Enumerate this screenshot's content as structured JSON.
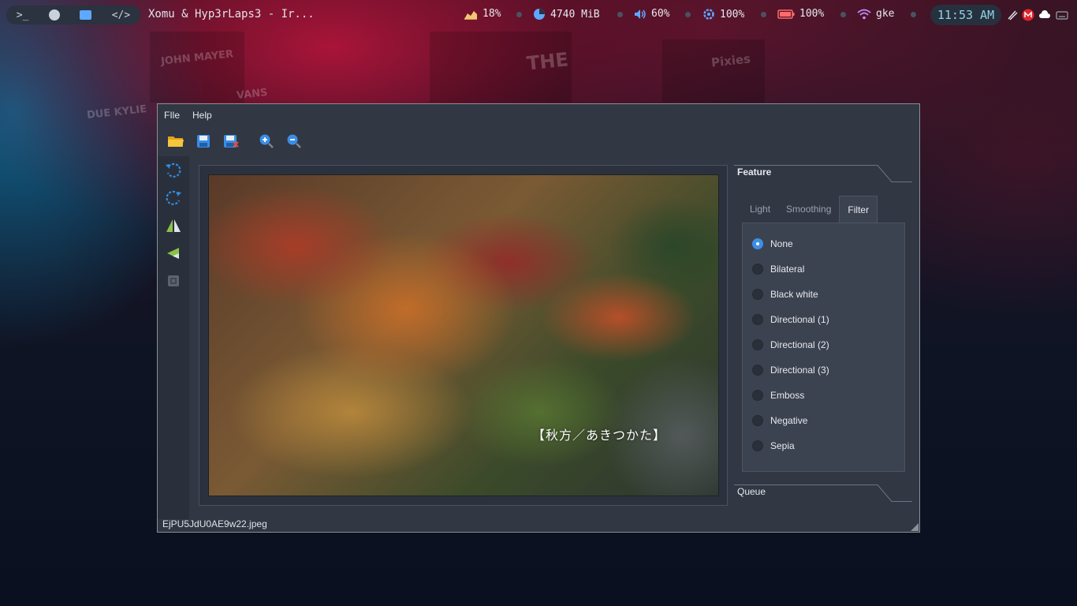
{
  "desktop": {
    "poster_texts": [
      "JOHN MAYER",
      "VANS",
      "Pixies",
      "THE",
      "DUE KYLIE"
    ]
  },
  "topbar": {
    "launcher": [
      {
        "name": "terminal-icon",
        "glyph": ">_"
      },
      {
        "name": "firefox-icon",
        "glyph": ""
      },
      {
        "name": "folder-icon",
        "glyph": ""
      },
      {
        "name": "code-icon",
        "glyph": "</>"
      }
    ],
    "window_title": "Xomu & Hyp3rLaps3 - Ir...",
    "cpu": "18%",
    "memory": "4740 MiB",
    "volume": "60%",
    "brightness": "100%",
    "battery": "100%",
    "wifi": "gke",
    "clock": "11:53 AM",
    "colors": {
      "accent": "#5fa8ff",
      "clock": "#8fd3e8",
      "battery": "#ff6b6b",
      "wifi": "#c58cff",
      "cpu": "#f0c674"
    }
  },
  "app": {
    "menu": [
      "FIle",
      "Help"
    ],
    "toolbar": [
      "open-folder-icon",
      "save-icon",
      "save-as-icon",
      "zoom-in-icon",
      "zoom-out-icon"
    ],
    "sidebar": [
      "rotate-left-icon",
      "rotate-right-icon",
      "flip-horizontal-icon",
      "flip-vertical-icon",
      "crop-icon"
    ],
    "image_caption": "【秋方／あきつかた】",
    "status_filename": "EjPU5JdU0AE9w22.jpeg",
    "feature_title": "Feature",
    "queue_title": "Queue",
    "tabs": [
      "Light",
      "Smoothing",
      "Filter"
    ],
    "active_tab": "Filter",
    "filters": [
      "None",
      "Bilateral",
      "Black white",
      "Directional (1)",
      "Directional (2)",
      "Directional (3)",
      "Emboss",
      "Negative",
      "Sepia"
    ],
    "selected_filter": "None"
  }
}
